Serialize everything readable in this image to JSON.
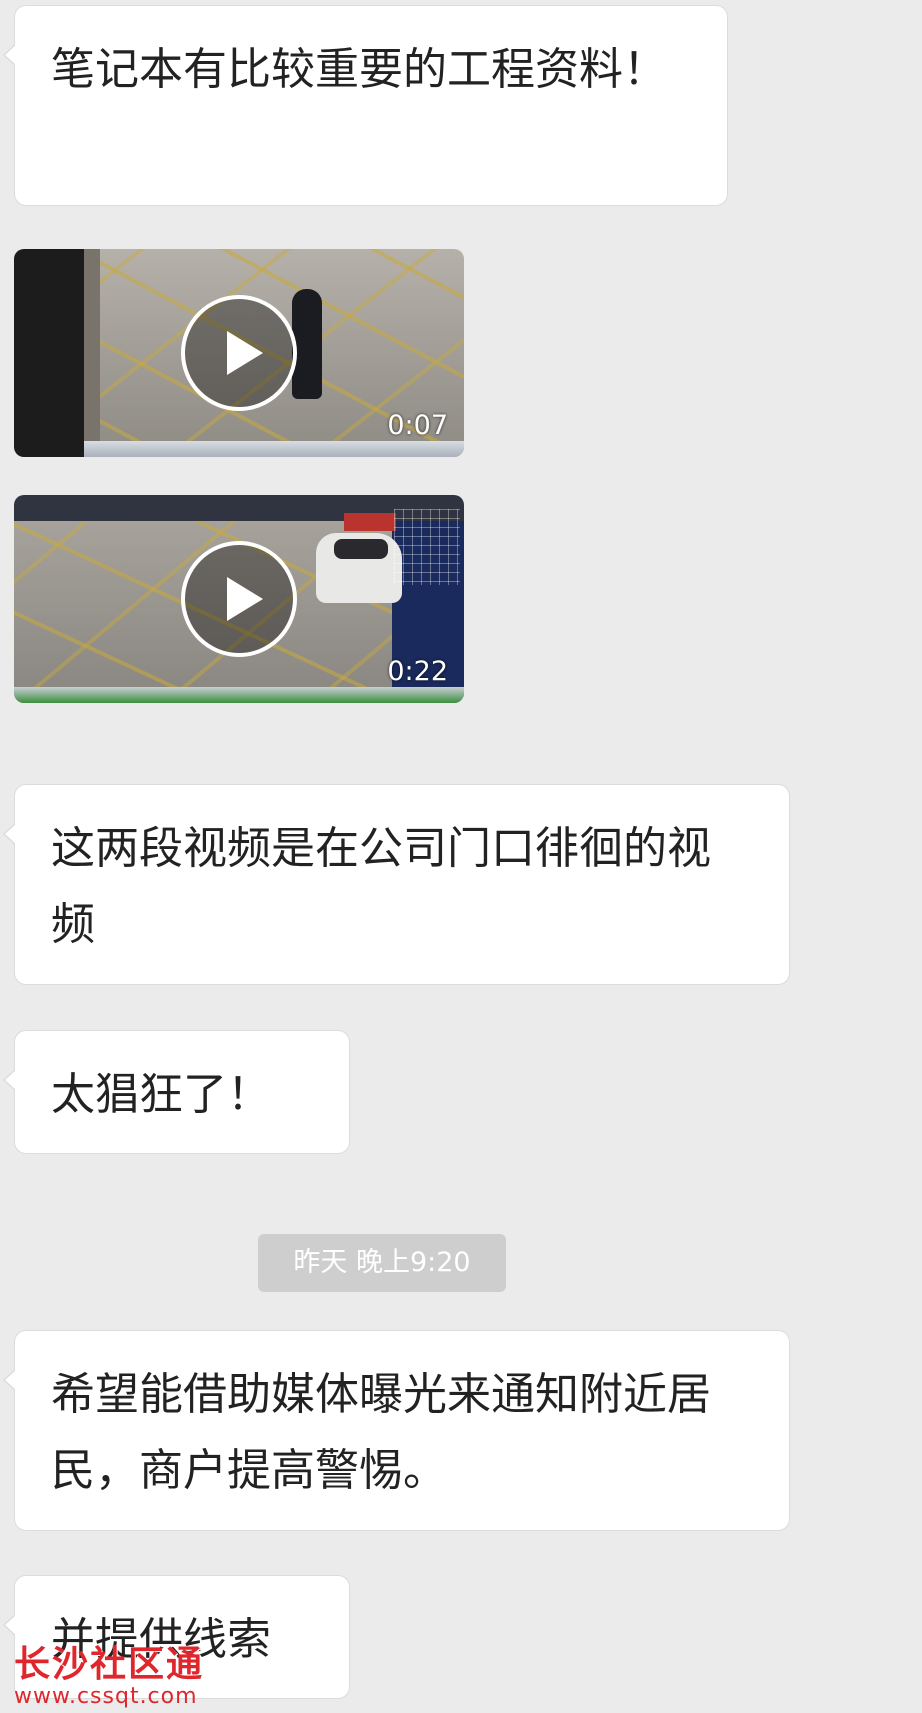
{
  "messages": [
    {
      "text": "笔记本有比较重要的工程资料！"
    },
    {
      "duration": "0:07"
    },
    {
      "duration": "0:22"
    },
    {
      "text": "这两段视频是在公司门口徘徊的视频"
    },
    {
      "text": "太猖狂了！"
    },
    {
      "timestamp": "昨天 晚上9:20"
    },
    {
      "text": "希望能借助媒体曝光来通知附近居民，商户提高警惕。"
    },
    {
      "text": "并提供线索"
    }
  ],
  "watermark": {
    "text": "长沙社区通",
    "url": "www.cssqt.com"
  }
}
